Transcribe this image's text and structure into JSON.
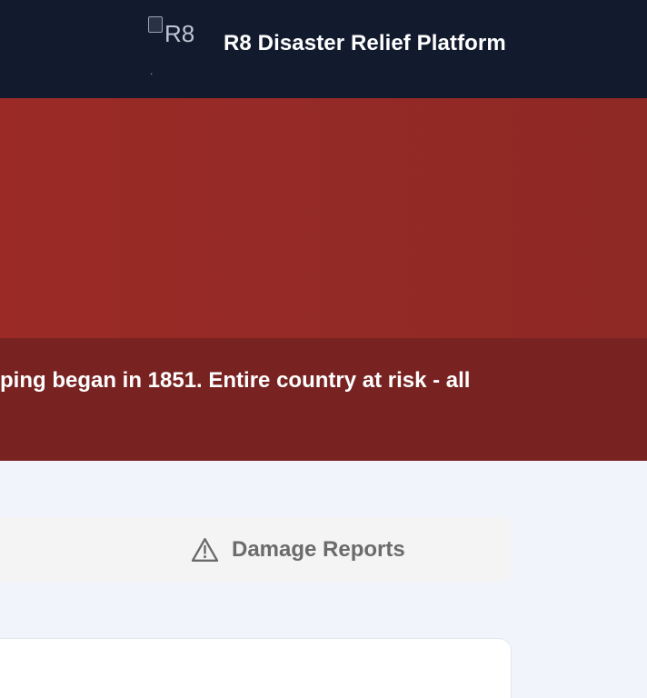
{
  "header": {
    "logo_alt": "R8",
    "logo_dot": ".",
    "title": "R8 Disaster Relief Platform"
  },
  "alert": {
    "message_visible": "ping began in 1851. Entire country at risk - all"
  },
  "tabs": [
    {
      "label": "Damage Reports",
      "icon": "warning-triangle-icon"
    }
  ],
  "colors": {
    "header_bg": "#121a2e",
    "alert_bg": "#9b2a26",
    "alert_strip_bg": "#782322",
    "page_bg": "#f1f5fb",
    "tab_bg": "#f4f4f4",
    "tab_text": "#6b6b6b"
  }
}
